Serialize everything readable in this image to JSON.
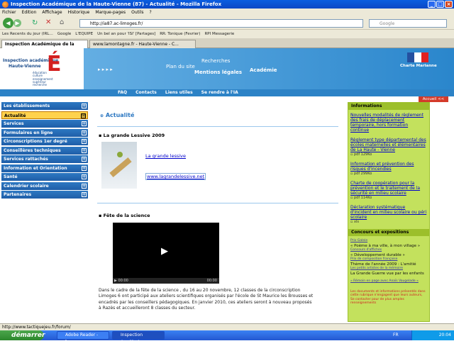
{
  "window": {
    "title": "Inspection Académique de la Haute-Vienne (87) - Actualité - Mozilla Firefox"
  },
  "menu": [
    "Fichier",
    "Edition",
    "Affichage",
    "Historique",
    "Marque-pages",
    "Outils",
    "?"
  ],
  "nav": {
    "url": "http://ia87.ac-limoges.fr/",
    "search_placeholder": "Google"
  },
  "bookmarks": [
    "Les Recents du jour (IRL…",
    "Google",
    "L'EQUIPE",
    "Un bel an pour 'ISI' [Partages]",
    "RR: Tonique (Fevrier)",
    "RPI Messagerie"
  ],
  "tabs": [
    {
      "label": "Inspection Académique de la Hau...",
      "active": true
    },
    {
      "label": "www.lamontagne.fr - Haute-Vienne - C...",
      "active": false
    }
  ],
  "banner": {
    "logo_line1": "Inspection académique",
    "logo_line2": "Haute-Vienne",
    "logo_tagline": "éducation\nculture\nenseignement\nsupérieur\nrecherche",
    "links": [
      "Plan du site",
      "Recherches",
      "Mentions légales",
      "Académie"
    ],
    "charter": "Charte Marianne",
    "subnav": [
      "FAQ",
      "Contacts",
      "Liens utiles",
      "Se rendre à l'IA"
    ]
  },
  "accueil_label": "Accueil <<",
  "sidebar": [
    {
      "label": "Les établissements",
      "active": false
    },
    {
      "label": "Actualité",
      "active": true
    },
    {
      "label": "Services",
      "active": false
    },
    {
      "label": "Formulaires en ligne",
      "active": false
    },
    {
      "label": "Circonscriptions 1er degré",
      "active": false
    },
    {
      "label": "Conseillères techniques",
      "active": false
    },
    {
      "label": "Services rattachés",
      "active": false
    },
    {
      "label": "Information et Orientation",
      "active": false
    },
    {
      "label": "Santé",
      "active": false
    },
    {
      "label": "Calendrier scolaire",
      "active": false
    },
    {
      "label": "Partenaires",
      "active": false
    }
  ],
  "main": {
    "title": "Actualité",
    "article1": {
      "title": "La grande Lessive 2009",
      "link1": "La grande lessive",
      "link2": "www.lagrandelessive.net"
    },
    "article2": {
      "title": "Fête de la science",
      "body": "Dans le cadre de la fête de la science , du 16 au 20 novembre, 12 classes de la circonscription Limoges 6 ont participé aux ateliers scientifiques organisés par l'école de St Maurice les Brousses et encadrés par les conseillers pédagogiques. En janvier 2010, ces ateliers seront à nouveau proposés à Razès et accueilleront 8 classes du secteur.",
      "video_time": "00:00",
      "video_end": "00:00"
    }
  },
  "right": {
    "informations": "Informations",
    "items": [
      {
        "text": "Nouvelles modalités de règlement des frais de déplacement temporaire, hors formation continue",
        "note": ""
      },
      {
        "text": "Règlement type départemental des écoles maternelles et élémentaires de La Haute - Vienne",
        "note": "pdf 129Ko"
      },
      {
        "text": "Information et prévention des risques d'incendies",
        "note": "pdf 299Ko"
      },
      {
        "text": "Charte de coopération pour la prévention et le traitement de la sécurité en milieu scolaire",
        "note": "pdf 114Ko"
      },
      {
        "text": "Déclaration systématique d'incident en milieu scolaire ou péri scolaire",
        "note": "xls"
      }
    ],
    "concours": "Concours et expositions",
    "prix_galeie": "Prix Galeie",
    "poeme": "« Poème à ma ville, à mon village »",
    "concours_affiches": "Concours d'affiches",
    "dev_durable": "« Développement durable »",
    "prix_compo": "Prix de composition française",
    "theme": "Thème de l'année 2009 : L'amitié",
    "petits": "Les petits artistes de la mémoire",
    "grande_guerre": "La Grande Guerre vue par les enfants",
    "vaugelade": "» Rémoin en page avec Anaïs Vaugelade «",
    "docs_red": "Les documents et informations présentés dans cette rubrique n'engagent que leurs auteurs, Se contacter pour de plus amples renseignements"
  },
  "status": "http://www.tactiquejeu.fr/forum/",
  "taskbar": {
    "start": "démarrer",
    "tasks": [
      {
        "label": "Adobe Reader - [pro...",
        "active": false
      },
      {
        "label": "Inspection Académiq...",
        "active": true
      }
    ],
    "lang": "FR",
    "time": "20:04"
  }
}
